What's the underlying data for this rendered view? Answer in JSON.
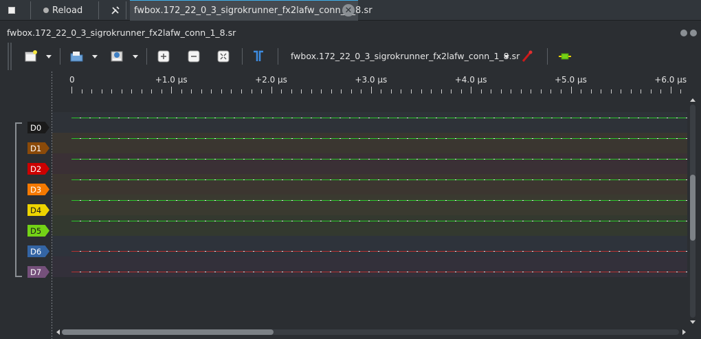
{
  "tabbar": {
    "reload_label": "Reload",
    "file_tab_label": "fwbox.172_22_0_3_sigrokrunner_fx2lafw_conn_1_8.sr",
    "close_glyph": "✕"
  },
  "session": {
    "title": "fwbox.172_22_0_3_sigrokrunner_fx2lafw_conn_1_8.sr"
  },
  "toolbar": {
    "device_name": "fwbox.172_22_0_3_sigrokrunner_fx2lafw_conn_1_8.sr",
    "icons": [
      "new-session-icon",
      "open-file-icon",
      "save-icon",
      "zoom-in-icon",
      "zoom-out-icon",
      "zoom-fit-icon",
      "cursor-icon",
      "probe-icon",
      "decoder-icon"
    ]
  },
  "ruler": {
    "labels": [
      "0",
      "+1.0 µs",
      "+2.0 µs",
      "+3.0 µs",
      "+4.0 µs",
      "+5.0 µs",
      "+6.0 µs"
    ]
  },
  "channels": [
    {
      "name": "D0",
      "color": "#1a1a1a",
      "lane": "#2e3238",
      "level": "high"
    },
    {
      "name": "D1",
      "color": "#8a4a09",
      "lane": "#3a3630",
      "level": "high"
    },
    {
      "name": "D2",
      "color": "#cc0000",
      "lane": "#3a3035",
      "level": "high"
    },
    {
      "name": "D3",
      "color": "#f57900",
      "lane": "#3c3630",
      "level": "high"
    },
    {
      "name": "D4",
      "color": "#edd400",
      "lane": "#3a3a30",
      "level": "high"
    },
    {
      "name": "D5",
      "color": "#73d216",
      "lane": "#33392f",
      "level": "high"
    },
    {
      "name": "D6",
      "color": "#3465a4",
      "lane": "#2e333b",
      "level": "low"
    },
    {
      "name": "D7",
      "color": "#75507b",
      "lane": "#33303a",
      "level": "low"
    }
  ],
  "colors": {
    "high_trace": "#2bc82b",
    "low_trace": "#b83232",
    "accent": "#3daee9"
  }
}
